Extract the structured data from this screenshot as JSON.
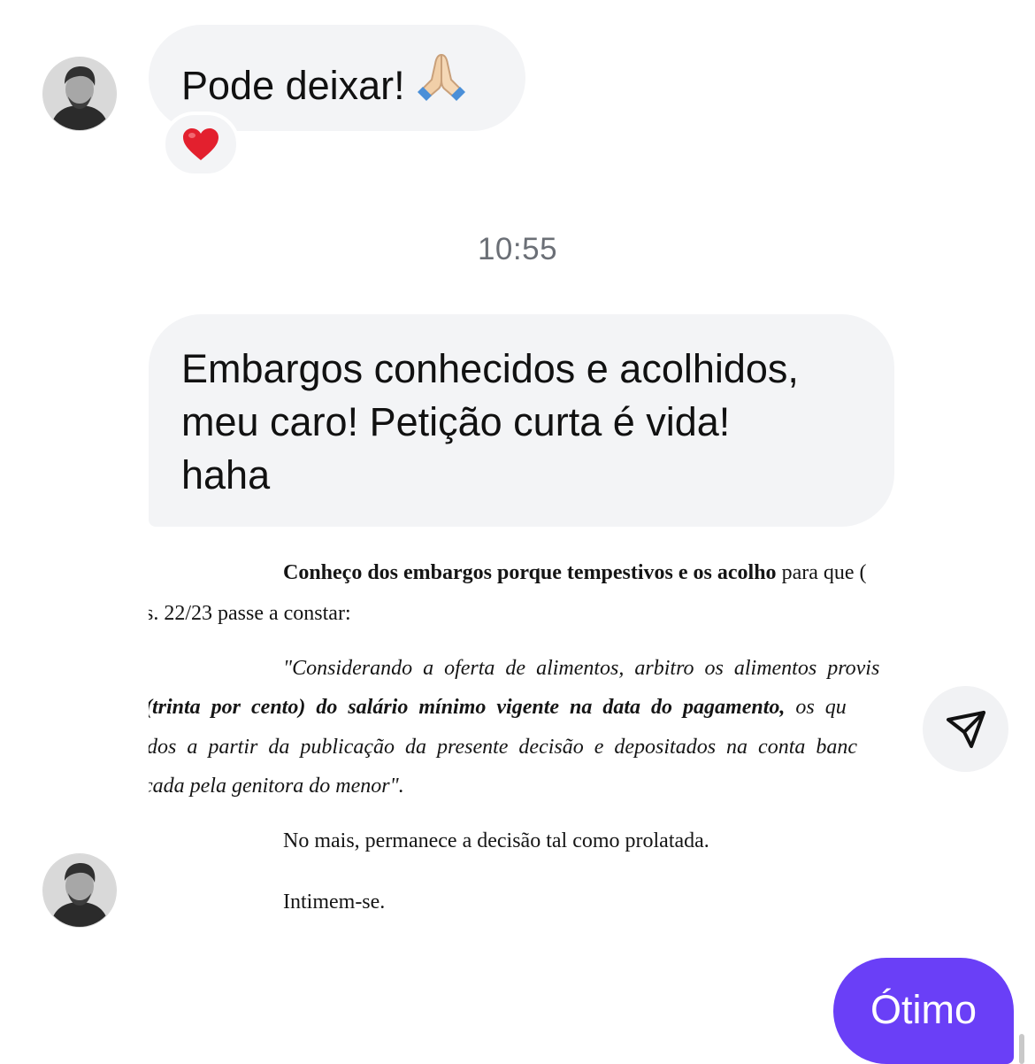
{
  "messages": [
    {
      "text": "Pode deixar!",
      "emoji": "folded-hands",
      "reaction": "heart"
    },
    {
      "text_lines": [
        "Embargos conhecidos e acolhidos,",
        "meu caro! Petição curta é vida!",
        "haha"
      ]
    }
  ],
  "timestamp": "10:55",
  "document": {
    "line1_bold": "Conheço dos embargos porque tempestivos e os acolho",
    "line1_rest": " para que (",
    "line2": "s. 22/23 passe a constar:",
    "line3": "\"Considerando a oferta de alimentos, arbitro os alimentos provis",
    "line4_start": "(",
    "line4_bold": "(trinta por cento) do salário mínimo vigente na data do pagamento,",
    "line4_rest": " os qu",
    "line5": "dos a partir da publicação da presente decisão e depositados na conta banc",
    "line6": "cada pela genitora do menor\".",
    "line7": "No mais, permanece a decisão tal como prolatada.",
    "line8": "Intimem-se."
  },
  "reply": {
    "text": "Ótimo"
  },
  "colors": {
    "bubble_in": "#f3f4f6",
    "bubble_out": "#6a3ff7",
    "timestamp": "#6b6f76"
  },
  "icons": {
    "share": "send-icon",
    "reaction": "heart-icon",
    "emoji": "folded-hands-icon"
  }
}
